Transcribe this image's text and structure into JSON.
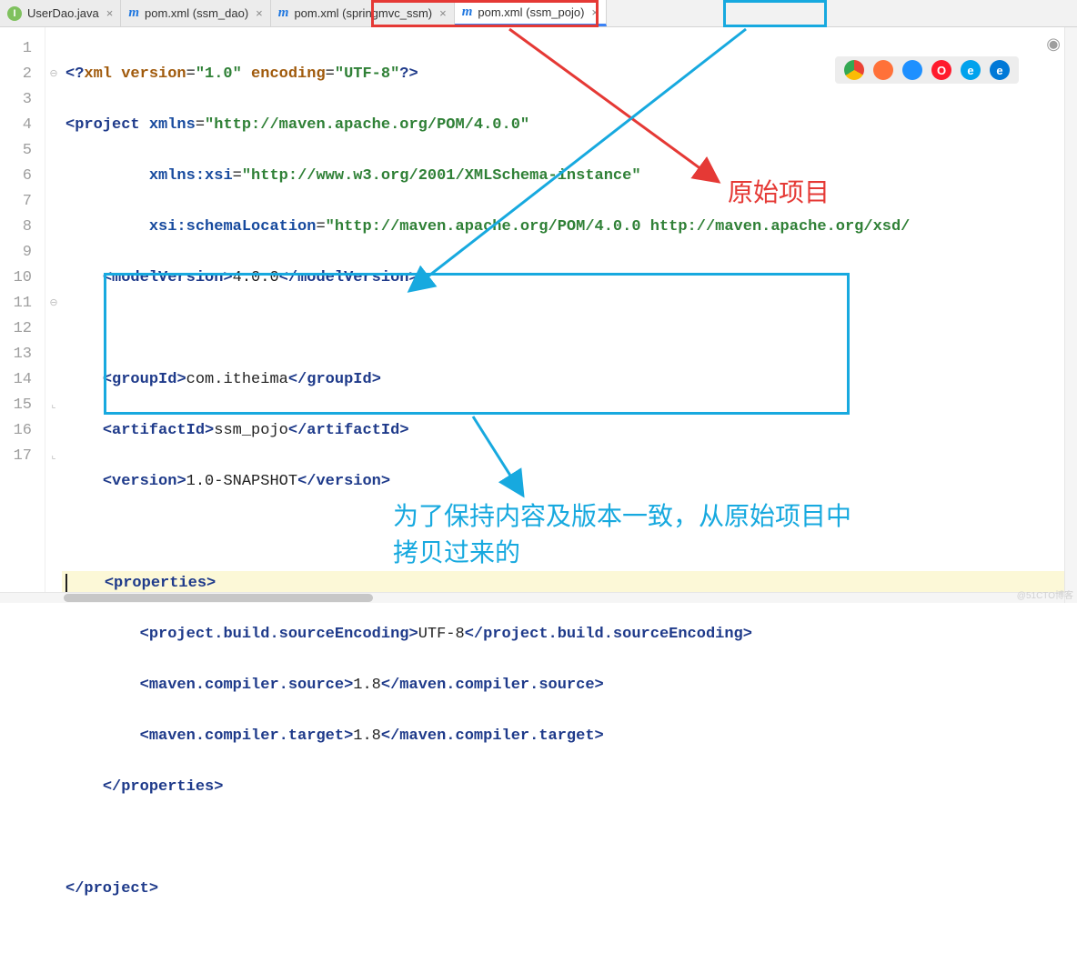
{
  "tabs": [
    {
      "icon": "j",
      "label": "UserDao.java"
    },
    {
      "icon": "m",
      "label": "pom.xml (ssm_dao)"
    },
    {
      "icon": "m",
      "label": "pom.xml (springmvc_ssm)"
    },
    {
      "icon": "m",
      "label": "pom.xml (ssm_pojo)",
      "active": true
    }
  ],
  "line_numbers": [
    "1",
    "2",
    "3",
    "4",
    "5",
    "6",
    "7",
    "8",
    "9",
    "10",
    "11",
    "12",
    "13",
    "14",
    "15",
    "16",
    "17"
  ],
  "code": {
    "l1_pre": "<?",
    "l1_xml": "xml version",
    "l1_eq1": "=",
    "l1_v1": "\"1.0\"",
    "l1_enc": " encoding",
    "l1_eq2": "=",
    "l1_v2": "\"UTF-8\"",
    "l1_post": "?>",
    "l2_a": "<",
    "l2_tag": "project",
    "l2_sp": " ",
    "l2_attr": "xmlns",
    "l2_eq": "=",
    "l2_val": "\"http://maven.apache.org/POM/4.0.0\"",
    "l3_attr": "xmlns:xsi",
    "l3_eq": "=",
    "l3_val": "\"http://www.w3.org/2001/XMLSchema-instance\"",
    "l4_attr": "xsi:schemaLocation",
    "l4_eq": "=",
    "l4_val": "\"http://maven.apache.org/POM/4.0.0 http://maven.apache.org/xsd/",
    "l5_o": "<",
    "l5_t": "modelVersion",
    "l5_c": ">",
    "l5_v": "4.0.0",
    "l5_o2": "</",
    "l5_t2": "modelVersion",
    "l5_c2": ">",
    "l7_o": "<",
    "l7_t": "groupId",
    "l7_c": ">",
    "l7_v": "com.itheima",
    "l7_o2": "</",
    "l7_t2": "groupId",
    "l7_c2": ">",
    "l8_o": "<",
    "l8_t": "artifactId",
    "l8_c": ">",
    "l8_v": "ssm_pojo",
    "l8_o2": "</",
    "l8_t2": "artifactId",
    "l8_c2": ">",
    "l9_o": "<",
    "l9_t": "version",
    "l9_c": ">",
    "l9_v": "1.0-SNAPSHOT",
    "l9_o2": "</",
    "l9_t2": "version",
    "l9_c2": ">",
    "l11_o": "<",
    "l11_t": "properties",
    "l11_c": ">",
    "l12_o": "<",
    "l12_t": "project.build.sourceEncoding",
    "l12_c": ">",
    "l12_v": "UTF-8",
    "l12_o2": "</",
    "l12_t2": "project.build.sourceEncoding",
    "l12_c2": ">",
    "l13_o": "<",
    "l13_t": "maven.compiler.source",
    "l13_c": ">",
    "l13_v": "1.8",
    "l13_o2": "</",
    "l13_t2": "maven.compiler.source",
    "l13_c2": ">",
    "l14_o": "<",
    "l14_t": "maven.compiler.target",
    "l14_c": ">",
    "l14_v": "1.8",
    "l14_o2": "</",
    "l14_t2": "maven.compiler.target",
    "l14_c2": ">",
    "l15_o": "</",
    "l15_t": "properties",
    "l15_c": ">",
    "l17_o": "</",
    "l17_t": "project",
    "l17_c": ">"
  },
  "annotations": {
    "red_label": "原始项目",
    "blue_label_line1": "为了保持内容及版本一致，从原始项目中",
    "blue_label_line2": "拷贝过来的"
  },
  "watermark": "@51CTO博客"
}
